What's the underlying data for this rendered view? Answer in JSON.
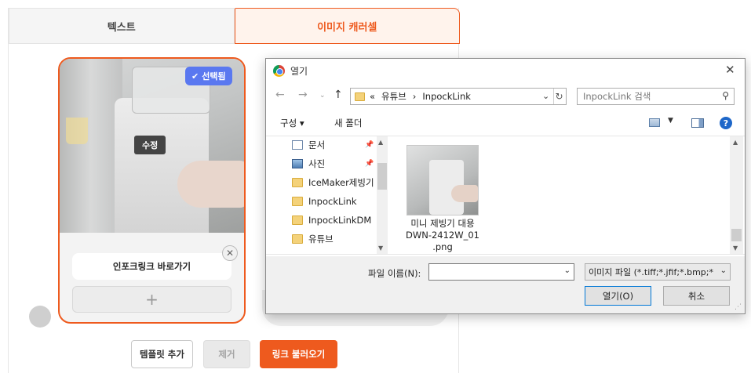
{
  "editor": {
    "tabs": [
      {
        "label": "텍스트",
        "active": false
      },
      {
        "label": "이미지 캐러셀",
        "active": true
      }
    ],
    "card": {
      "badge": "선택됨",
      "edit_label": "수정",
      "link_text": "인포크링크 바로가기",
      "close_glyph": "✕",
      "add_glyph": "+"
    },
    "buttons": {
      "add_template": "템플릿 추가",
      "remove": "제거",
      "load_link": "링크 불러오기"
    },
    "accent_color": "#ee5a1e",
    "badge_color": "#5a78f0"
  },
  "dialog": {
    "title": "열기",
    "address": {
      "prefix": "«",
      "segments": [
        "유튜브",
        "InpockLink"
      ],
      "separator": "›"
    },
    "search_placeholder": "InpockLink 검색",
    "toolbar": {
      "organize": "구성 ▾",
      "new_folder": "새 폴더"
    },
    "tree": [
      {
        "label": "문서",
        "icon": "document-icon",
        "pinned": true
      },
      {
        "label": "사진",
        "icon": "pictures-icon",
        "pinned": true
      },
      {
        "label": "IceMaker제빙기",
        "icon": "folder-icon",
        "pinned": false
      },
      {
        "label": "InpockLink",
        "icon": "folder-icon",
        "pinned": false
      },
      {
        "label": "InpockLinkDM",
        "icon": "folder-icon",
        "pinned": false
      },
      {
        "label": "유튜브",
        "icon": "folder-icon",
        "pinned": false
      }
    ],
    "file": {
      "name_line1": "미니 제빙기 대용",
      "name_line2": "DWN-2412W_01",
      "name_line3": ".png"
    },
    "filename_label": "파일 이름(N):",
    "filename_value": "",
    "filetype": "이미지 파일 (*.tiff;*.jfif;*.bmp;*",
    "open_button": "열기(O)",
    "cancel_button": "취소"
  }
}
